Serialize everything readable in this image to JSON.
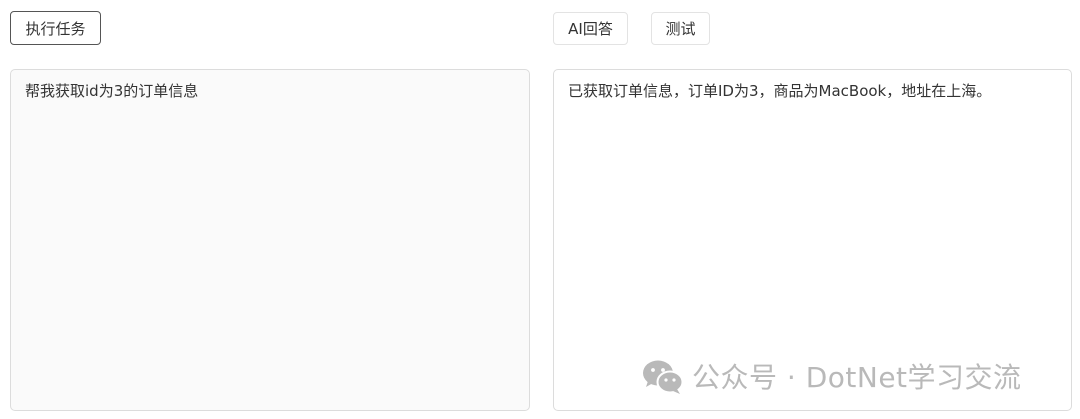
{
  "toolbar": {
    "run_task_label": "执行任务",
    "ai_answer_label": "AI回答",
    "test_label": "测试"
  },
  "task_input": {
    "value": "帮我获取id为3的订单信息"
  },
  "answer_output": {
    "value": "已获取订单信息，订单ID为3，商品为MacBook，地址在上海。"
  },
  "watermark": {
    "icon": "wechat-icon",
    "text": "公众号 · DotNet学习交流"
  }
}
